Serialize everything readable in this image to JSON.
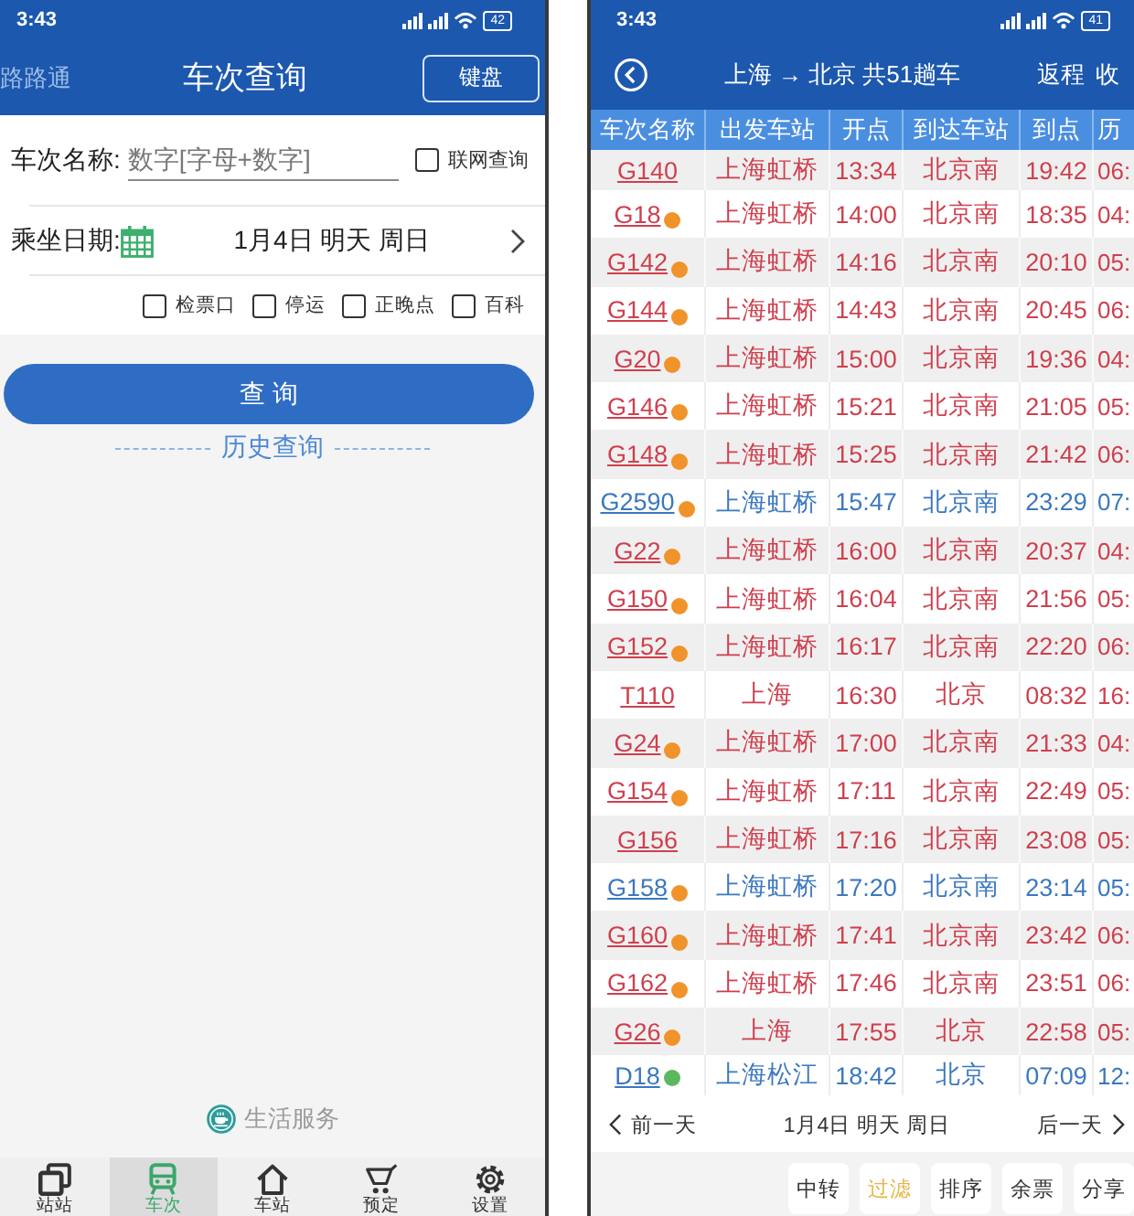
{
  "left_screen": {
    "status_bar": {
      "time": "3:43",
      "battery": "42"
    },
    "header": {
      "app_name": "路路通",
      "title": "车次查询",
      "keyboard_button": "键盘"
    },
    "train_field": {
      "label": "车次名称:",
      "placeholder": "数字[字母+数字]"
    },
    "online_query": {
      "label": "联网查询",
      "checked": false
    },
    "date_row": {
      "label": "乘坐日期:",
      "value": "1月4日 明天 周日"
    },
    "options": [
      {
        "label": "检票口",
        "checked": false
      },
      {
        "label": "停运",
        "checked": false
      },
      {
        "label": "正晚点",
        "checked": false
      },
      {
        "label": "百科",
        "checked": false
      }
    ],
    "search_button": "查 询",
    "history_link": "历史查询",
    "life_services": "生活服务",
    "tabs": [
      {
        "label": "站站",
        "selected": false
      },
      {
        "label": "车次",
        "selected": true
      },
      {
        "label": "车站",
        "selected": false
      },
      {
        "label": "预定",
        "selected": false
      },
      {
        "label": "设置",
        "selected": false
      }
    ]
  },
  "right_screen": {
    "status_bar": {
      "time": "3:43",
      "battery": "41"
    },
    "header": {
      "title": "上海 → 北京 共51趟车",
      "actions": [
        "返程",
        "收"
      ]
    },
    "table": {
      "columns": [
        "车次名称",
        "出发车站",
        "开点",
        "到达车站",
        "到点",
        "历"
      ],
      "rows": [
        {
          "cells": [
            "G140",
            "上海虹桥",
            "13:34",
            "北京南",
            "19:42",
            "06:"
          ],
          "color": "#cf3f4d"
        },
        {
          "cells": [
            "G18",
            "上海虹桥",
            "14:00",
            "北京南",
            "18:35",
            "04:"
          ],
          "badge": {
            "color": "#f0932b"
          },
          "color": "#cf3f4d"
        },
        {
          "cells": [
            "G142",
            "上海虹桥",
            "14:16",
            "北京南",
            "20:10",
            "05:"
          ],
          "badge": {
            "color": "#f0932b"
          },
          "color": "#cf3f4d"
        },
        {
          "cells": [
            "G144",
            "上海虹桥",
            "14:43",
            "北京南",
            "20:45",
            "06:"
          ],
          "badge": {
            "color": "#f0932b"
          },
          "color": "#cf3f4d"
        },
        {
          "cells": [
            "G20",
            "上海虹桥",
            "15:00",
            "北京南",
            "19:36",
            "04:"
          ],
          "badge": {
            "color": "#f0932b"
          },
          "color": "#cf3f4d"
        },
        {
          "cells": [
            "G146",
            "上海虹桥",
            "15:21",
            "北京南",
            "21:05",
            "05:"
          ],
          "badge": {
            "color": "#f0932b"
          },
          "color": "#cf3f4d"
        },
        {
          "cells": [
            "G148",
            "上海虹桥",
            "15:25",
            "北京南",
            "21:42",
            "06:"
          ],
          "badge": {
            "color": "#f0932b"
          },
          "color": "#cf3f4d"
        },
        {
          "cells": [
            "G2590",
            "上海虹桥",
            "15:47",
            "北京南",
            "23:29",
            "07:"
          ],
          "badge": {
            "color": "#f0932b"
          },
          "color": "#3b78bf"
        },
        {
          "cells": [
            "G22",
            "上海虹桥",
            "16:00",
            "北京南",
            "20:37",
            "04:"
          ],
          "badge": {
            "color": "#f0932b"
          },
          "color": "#cf3f4d"
        },
        {
          "cells": [
            "G150",
            "上海虹桥",
            "16:04",
            "北京南",
            "21:56",
            "05:"
          ],
          "badge": {
            "color": "#f0932b"
          },
          "color": "#cf3f4d"
        },
        {
          "cells": [
            "G152",
            "上海虹桥",
            "16:17",
            "北京南",
            "22:20",
            "06:"
          ],
          "badge": {
            "color": "#f0932b"
          },
          "color": "#cf3f4d"
        },
        {
          "cells": [
            "T110",
            "上海",
            "16:30",
            "北京",
            "08:32",
            "16:"
          ],
          "color": "#cf3f4d"
        },
        {
          "cells": [
            "G24",
            "上海虹桥",
            "17:00",
            "北京南",
            "21:33",
            "04:"
          ],
          "badge": {
            "color": "#f0932b"
          },
          "color": "#cf3f4d"
        },
        {
          "cells": [
            "G154",
            "上海虹桥",
            "17:11",
            "北京南",
            "22:49",
            "05:"
          ],
          "badge": {
            "color": "#f0932b"
          },
          "color": "#cf3f4d"
        },
        {
          "cells": [
            "G156",
            "上海虹桥",
            "17:16",
            "北京南",
            "23:08",
            "05:"
          ],
          "color": "#cf3f4d"
        },
        {
          "cells": [
            "G158",
            "上海虹桥",
            "17:20",
            "北京南",
            "23:14",
            "05:"
          ],
          "badge": {
            "color": "#f0932b"
          },
          "color": "#3b78bf"
        },
        {
          "cells": [
            "G160",
            "上海虹桥",
            "17:41",
            "北京南",
            "23:42",
            "06:"
          ],
          "badge": {
            "color": "#f0932b"
          },
          "color": "#cf3f4d"
        },
        {
          "cells": [
            "G162",
            "上海虹桥",
            "17:46",
            "北京南",
            "23:51",
            "06:"
          ],
          "badge": {
            "color": "#f0932b"
          },
          "color": "#cf3f4d"
        },
        {
          "cells": [
            "G26",
            "上海",
            "17:55",
            "北京",
            "22:58",
            "05:"
          ],
          "badge": {
            "color": "#f0932b"
          },
          "color": "#cf3f4d"
        },
        {
          "cells": [
            "D18",
            "上海松江",
            "18:42",
            "北京",
            "07:09",
            "12:"
          ],
          "badge": {
            "color": "#5cb85c"
          },
          "color": "#3b78bf"
        }
      ]
    },
    "date_nav": {
      "previous": "前一天",
      "date": "1月4日 明天 周日",
      "next": "后一天"
    },
    "toolbar": [
      {
        "label": "中转",
        "selected": false
      },
      {
        "label": "过滤",
        "selected": true
      },
      {
        "label": "排序",
        "selected": false
      },
      {
        "label": "余票",
        "selected": false
      },
      {
        "label": "分享",
        "selected": false
      }
    ]
  }
}
